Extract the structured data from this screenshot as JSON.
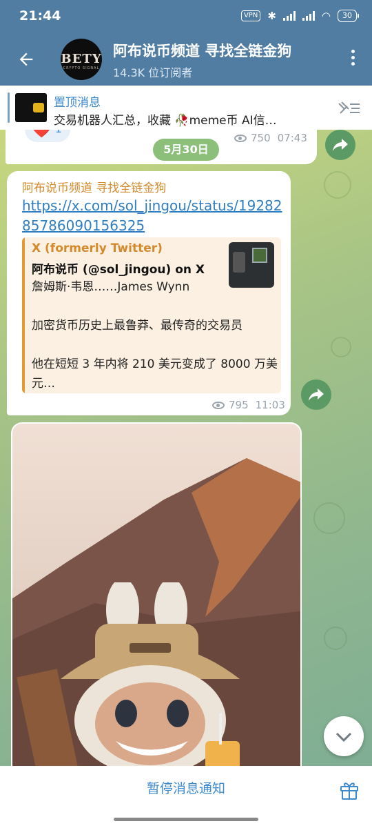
{
  "status_bar": {
    "time": "21:44",
    "vpn": "VPN",
    "battery": "30",
    "net1": "HD",
    "net2": "HD"
  },
  "header": {
    "back_icon": "arrow-left-icon",
    "channel_title": "阿布说币频道 寻找全链金狗",
    "subscribers": "14.3K 位订阅者",
    "avatar_text": "BETY",
    "avatar_subtext": "CRYPTO SIGNAL",
    "menu_icon": "more-vertical-icon"
  },
  "pinned": {
    "label": "置顶消息",
    "text": "交易机器人汇总，收藏 🥀meme币  AI信…",
    "unpin_icon": "unpin-icon"
  },
  "messages": [
    {
      "id": "msg-1",
      "reaction_emoji": "❤️",
      "reaction_count": "1",
      "date_pill": "5月30日",
      "views": "750",
      "time": "07:43"
    },
    {
      "id": "msg-2",
      "sender": "阿布说币频道 寻找全链金狗",
      "link": "https://x.com/sol_jingou/status/1928285786090156325",
      "preview": {
        "site": "X (formerly Twitter)",
        "title": "阿布说币 (@sol_jingou) on X",
        "description": "詹姆斯·韦恩……James Wynn\n\n加密货币历史上最鲁莽、最传奇的交易员\n\n他在短短 3 年内将 210 美元变成了 8000 万美元…"
      },
      "views": "795",
      "time": "11:03"
    },
    {
      "id": "msg-3",
      "type": "photo"
    }
  ],
  "bottom_bar": {
    "mute_label": "暂停消息通知",
    "gift_icon": "gift-icon"
  },
  "colors": {
    "header_bg": "#517da2",
    "link": "#2f7ec1",
    "sender": "#d48a2a",
    "forward_button": "#5b9a64",
    "date_pill": "#8cc07a"
  }
}
